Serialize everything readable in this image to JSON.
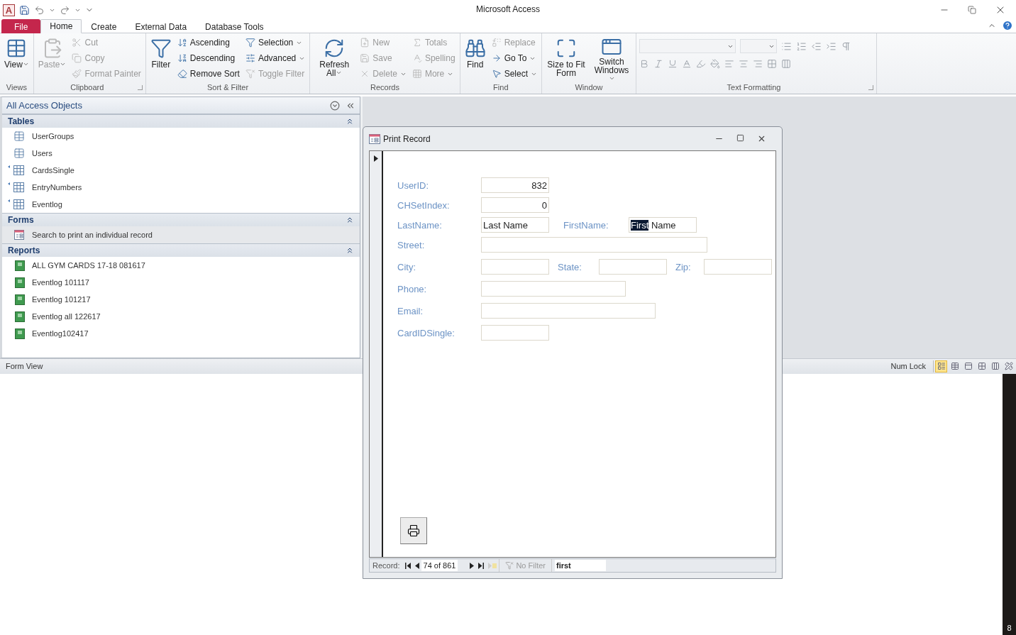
{
  "title_bar": {
    "logo": "A",
    "title": "Microsoft Access"
  },
  "ribbon_tabs": [
    {
      "label": "File",
      "kind": "file",
      "selected": false
    },
    {
      "label": "Home",
      "kind": "tab",
      "selected": true
    },
    {
      "label": "Create",
      "kind": "tab",
      "selected": false
    },
    {
      "label": "External Data",
      "kind": "tab",
      "selected": false
    },
    {
      "label": "Database Tools",
      "kind": "tab",
      "selected": false
    }
  ],
  "ribbon_groups": [
    {
      "label": "Views",
      "kind": "commands",
      "large": [
        {
          "label": "View",
          "disabled": false,
          "dropdown": true
        }
      ]
    },
    {
      "label": "Clipboard",
      "kind": "commands",
      "launcher": true,
      "large": [
        {
          "label": "Paste",
          "disabled": true,
          "dropdown": true
        }
      ],
      "small_columns": [
        [
          {
            "label": "Cut",
            "disabled": true,
            "dropdown": false
          },
          {
            "label": "Copy",
            "disabled": true,
            "dropdown": false
          },
          {
            "label": "Format Painter",
            "disabled": true,
            "dropdown": false
          }
        ]
      ]
    },
    {
      "label": "Sort & Filter",
      "kind": "commands",
      "large": [
        {
          "label": "Filter",
          "disabled": false,
          "dropdown": false
        }
      ],
      "small_columns": [
        [
          {
            "label": "Ascending",
            "disabled": false,
            "dropdown": false
          },
          {
            "label": "Descending",
            "disabled": false,
            "dropdown": false
          },
          {
            "label": "Remove Sort",
            "disabled": false,
            "dropdown": false
          }
        ],
        [
          {
            "label": "Selection",
            "disabled": false,
            "dropdown": true
          },
          {
            "label": "Advanced",
            "disabled": false,
            "dropdown": true
          },
          {
            "label": "Toggle Filter",
            "disabled": true,
            "dropdown": false
          }
        ]
      ]
    },
    {
      "label": "Records",
      "kind": "commands",
      "large": [
        {
          "label": "Refresh All",
          "disabled": false,
          "dropdown": true
        }
      ],
      "small_columns": [
        [
          {
            "label": "New",
            "disabled": true,
            "dropdown": false
          },
          {
            "label": "Save",
            "disabled": true,
            "dropdown": false
          },
          {
            "label": "Delete",
            "disabled": true,
            "dropdown": true
          }
        ],
        [
          {
            "label": "Totals",
            "disabled": true,
            "dropdown": false
          },
          {
            "label": "Spelling",
            "disabled": true,
            "dropdown": false
          },
          {
            "label": "More",
            "disabled": true,
            "dropdown": true
          }
        ]
      ]
    },
    {
      "label": "Find",
      "kind": "commands",
      "large": [
        {
          "label": "Find",
          "disabled": false,
          "dropdown": false
        }
      ],
      "small_columns": [
        [
          {
            "label": "Replace",
            "disabled": true,
            "dropdown": false
          },
          {
            "label": "Go To",
            "disabled": false,
            "dropdown": true
          },
          {
            "label": "Select",
            "disabled": false,
            "dropdown": true
          }
        ]
      ]
    },
    {
      "label": "Window",
      "kind": "commands",
      "large": [
        {
          "label": "Size to Fit Form",
          "disabled": false,
          "dropdown": false
        },
        {
          "label": "Switch Windows",
          "disabled": false,
          "dropdown": true
        }
      ]
    },
    {
      "label": "Text Formatting",
      "kind": "formatting",
      "launcher": true
    }
  ],
  "navigation_pane": {
    "title": "All Access Objects",
    "sections": [
      {
        "title": "Tables",
        "expanded": true,
        "items": [
          {
            "label": "UserGroups",
            "kind": "table",
            "selected": false
          },
          {
            "label": "Users",
            "kind": "table",
            "selected": false
          },
          {
            "label": "CardsSingle",
            "kind": "linked_table",
            "selected": false
          },
          {
            "label": "EntryNumbers",
            "kind": "linked_table",
            "selected": false
          },
          {
            "label": "Eventlog",
            "kind": "linked_table",
            "selected": false
          }
        ]
      },
      {
        "title": "Forms",
        "expanded": true,
        "items": [
          {
            "label": "Search to print an individual record",
            "kind": "form",
            "selected": true
          }
        ]
      },
      {
        "title": "Reports",
        "expanded": true,
        "items": [
          {
            "label": "ALL GYM CARDS 17-18 081617",
            "kind": "report",
            "selected": false
          },
          {
            "label": "Eventlog 101117",
            "kind": "report",
            "selected": false
          },
          {
            "label": "Eventlog 101217",
            "kind": "report",
            "selected": false
          },
          {
            "label": "Eventlog all 122617",
            "kind": "report",
            "selected": false
          },
          {
            "label": "Eventlog102417",
            "kind": "report",
            "selected": false
          }
        ]
      }
    ]
  },
  "form_window": {
    "title": "Print Record",
    "rows": [
      [
        {
          "label": "UserID:",
          "kind": "short",
          "numeric": true,
          "value_parts": [
            {
              "text": "832",
              "selected": false
            }
          ]
        }
      ],
      [
        {
          "label": "CHSetIndex:",
          "kind": "short",
          "numeric": true,
          "value_parts": [
            {
              "text": "0",
              "selected": false
            }
          ]
        }
      ],
      [
        {
          "label": "LastName:",
          "kind": "short",
          "numeric": false,
          "value_parts": [
            {
              "text": "Last Name",
              "selected": false
            }
          ]
        },
        {
          "label": "FirstName:",
          "kind": "short",
          "numeric": false,
          "value_parts": [
            {
              "text": "First",
              "selected": true
            },
            {
              "text": " Name",
              "selected": false
            }
          ]
        }
      ],
      [
        {
          "label": "Street:",
          "kind": "wide"
        }
      ],
      [
        {
          "label": "City:",
          "kind": "short"
        },
        {
          "label": "State:",
          "kind": "short"
        },
        {
          "label": "Zip:",
          "kind": "short"
        }
      ],
      [
        {
          "label": "Phone:",
          "kind": "medium"
        }
      ],
      [
        {
          "label": "Email:",
          "kind": "long"
        }
      ],
      [
        {
          "label": "CardIDSingle:",
          "kind": "short"
        }
      ]
    ],
    "record_navigator": {
      "label": "Record:",
      "position": "74 of 861",
      "filtered": false,
      "filter_label": "No Filter",
      "search": "first"
    }
  },
  "status_bar": {
    "left": "Form View",
    "indicator": "Num Lock",
    "views": [
      {
        "selected": true
      },
      {
        "selected": false
      },
      {
        "selected": false
      },
      {
        "selected": false
      },
      {
        "selected": false
      },
      {
        "selected": false
      }
    ]
  },
  "edge_fragment": "8"
}
